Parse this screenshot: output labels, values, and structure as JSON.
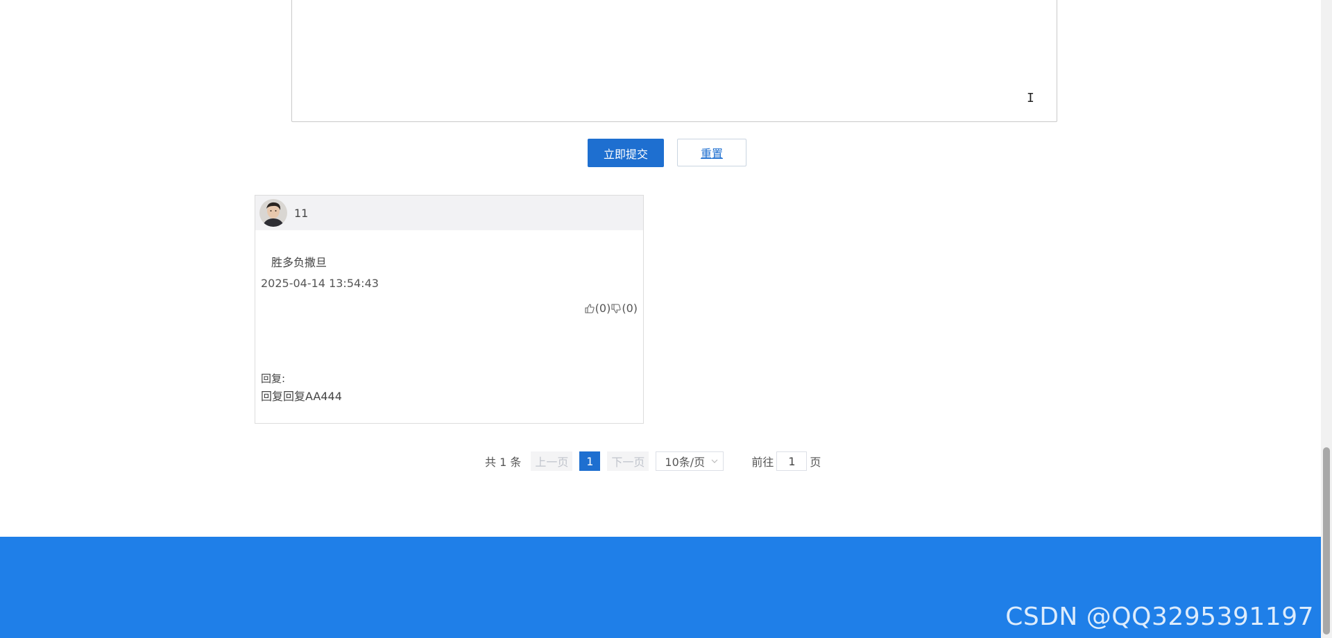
{
  "form": {
    "textarea_value": "",
    "submit_label": "立即提交",
    "reset_label": "重置"
  },
  "comment": {
    "username": "11",
    "content": "胜多负撒旦",
    "time": "2025-04-14 13:54:43",
    "likes": "(0)",
    "dislikes": "(0)",
    "reply_label": "回复:",
    "reply_text": "回复回复AA444"
  },
  "pagination": {
    "total": "共 1 条",
    "prev": "上一页",
    "current_page": "1",
    "next": "下一页",
    "page_size": "10条/页",
    "goto_label": "前往",
    "goto_value": "1",
    "page_suffix": "页"
  },
  "footer": {
    "watermark": "CSDN @QQ3295391197",
    "color": "#1f7fe8"
  },
  "colors": {
    "primary": "#1e6fd0"
  }
}
